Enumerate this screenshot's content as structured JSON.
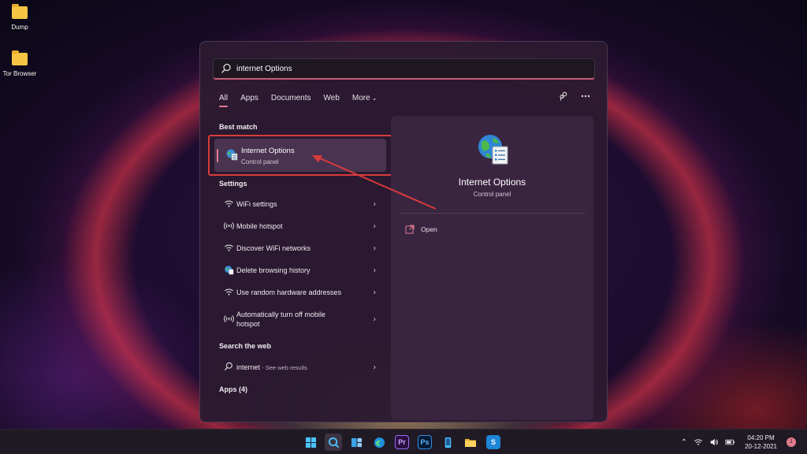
{
  "desktop": {
    "icons": [
      {
        "label": "Dump",
        "icon": "folder-icon"
      },
      {
        "label": "Tor Browser",
        "icon": "folder-icon"
      }
    ]
  },
  "search": {
    "value": "internet Options",
    "icon": "search-icon"
  },
  "filters": {
    "tabs": [
      "All",
      "Apps",
      "Documents",
      "Web",
      "More"
    ],
    "active": "All",
    "more_chevron": "⌄"
  },
  "best_match": {
    "heading": "Best match",
    "title": "Internet Options",
    "subtitle": "Control panel"
  },
  "settings": {
    "heading": "Settings",
    "items": [
      {
        "label": "WiFi settings",
        "icon": "wifi-icon"
      },
      {
        "label": "Mobile hotspot",
        "icon": "hotspot-icon"
      },
      {
        "label": "Discover WiFi networks",
        "icon": "wifi-icon"
      },
      {
        "label": "Delete browsing history",
        "icon": "internet-options-icon"
      },
      {
        "label": "Use random hardware addresses",
        "icon": "wifi-icon"
      },
      {
        "label": "Automatically turn off mobile hotspot",
        "icon": "hotspot-icon"
      }
    ]
  },
  "web": {
    "heading": "Search the web",
    "query": "internet",
    "suffix": " - See web results"
  },
  "apps": {
    "heading": "Apps (4)"
  },
  "preview": {
    "title": "Internet Options",
    "subtitle": "Control panel",
    "action_label": "Open"
  },
  "taskbar": {
    "apps": [
      "windows-start-icon",
      "search-icon",
      "widgets-icon",
      "edge-icon",
      "premiere-pro-icon",
      "photoshop-icon",
      "phone-icon",
      "file-explorer-icon",
      "snagit-icon"
    ],
    "premiere_label": "Pr",
    "photoshop_label": "Ps",
    "snagit_label": "S",
    "time": "04:20 PM",
    "date": "20-12-2021",
    "notifications": "1"
  },
  "colors": {
    "accent": "#e07a95",
    "annotation_red": "#d83b3b"
  }
}
